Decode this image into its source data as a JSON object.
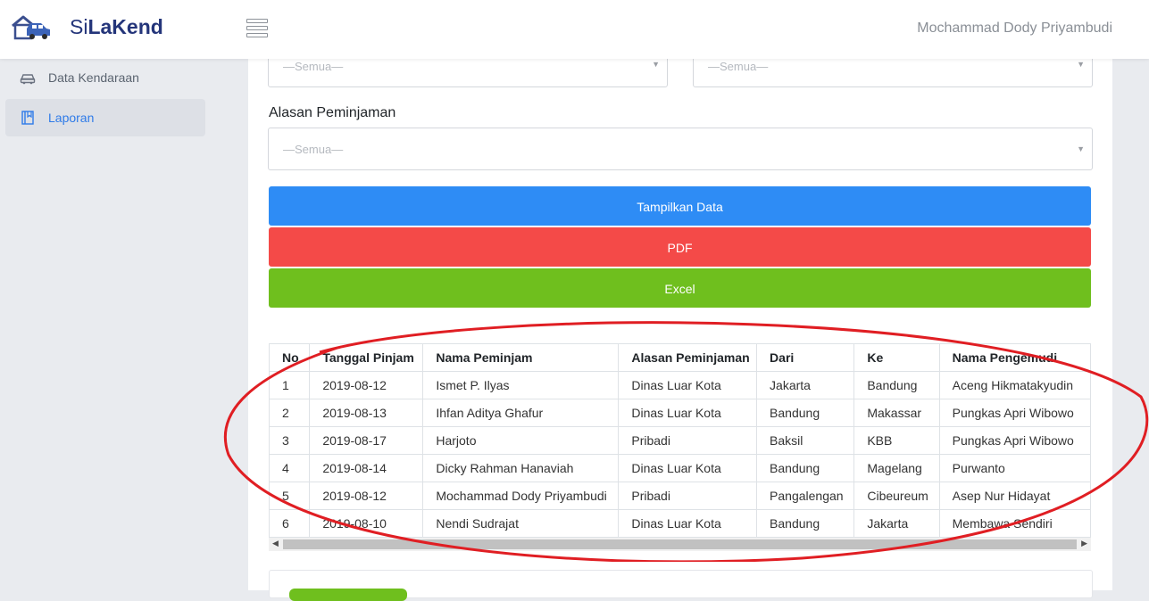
{
  "header": {
    "brand_prefix": "Si",
    "brand_suffix": "LaKend",
    "user_name": "Mochammad Dody Priyambudi"
  },
  "sidebar": {
    "items": [
      {
        "label": "Data Kendaraan",
        "icon": "car-icon",
        "active": false
      },
      {
        "label": "Laporan",
        "icon": "book-icon",
        "active": true
      }
    ]
  },
  "filters": {
    "select_left_placeholder": "—Semua—",
    "select_right_placeholder": "—Semua—",
    "alasan_label": "Alasan Peminjaman",
    "alasan_placeholder": "—Semua—"
  },
  "buttons": {
    "show_data": "Tampilkan Data",
    "pdf": "PDF",
    "excel": "Excel"
  },
  "table": {
    "columns": [
      "No",
      "Tanggal Pinjam",
      "Nama Peminjam",
      "Alasan Peminjaman",
      "Dari",
      "Ke",
      "Nama Pengemudi"
    ],
    "rows": [
      [
        "1",
        "2019-08-12",
        "Ismet P. Ilyas",
        "Dinas Luar Kota",
        "Jakarta",
        "Bandung",
        "Aceng Hikmatakyudin"
      ],
      [
        "2",
        "2019-08-13",
        "Ihfan Aditya Ghafur",
        "Dinas Luar Kota",
        "Bandung",
        "Makassar",
        "Pungkas Apri Wibowo"
      ],
      [
        "3",
        "2019-08-17",
        "Harjoto",
        "Pribadi",
        "Baksil",
        "KBB",
        "Pungkas Apri Wibowo"
      ],
      [
        "4",
        "2019-08-14",
        "Dicky Rahman Hanaviah",
        "Dinas Luar Kota",
        "Bandung",
        "Magelang",
        "Purwanto"
      ],
      [
        "5",
        "2019-08-12",
        "Mochammad Dody Priyambudi",
        "Pribadi",
        "Pangalengan",
        "Cibeureum",
        "Asep Nur Hidayat"
      ],
      [
        "6",
        "2019-08-10",
        "Nendi Sudrajat",
        "Dinas Luar Kota",
        "Bandung",
        "Jakarta",
        "Membawa Sendiri"
      ]
    ]
  },
  "colors": {
    "brand": "#24357a",
    "primary": "#2e8cf5",
    "danger": "#f44a48",
    "success": "#6fbf1e",
    "annotation": "#e01e23"
  }
}
